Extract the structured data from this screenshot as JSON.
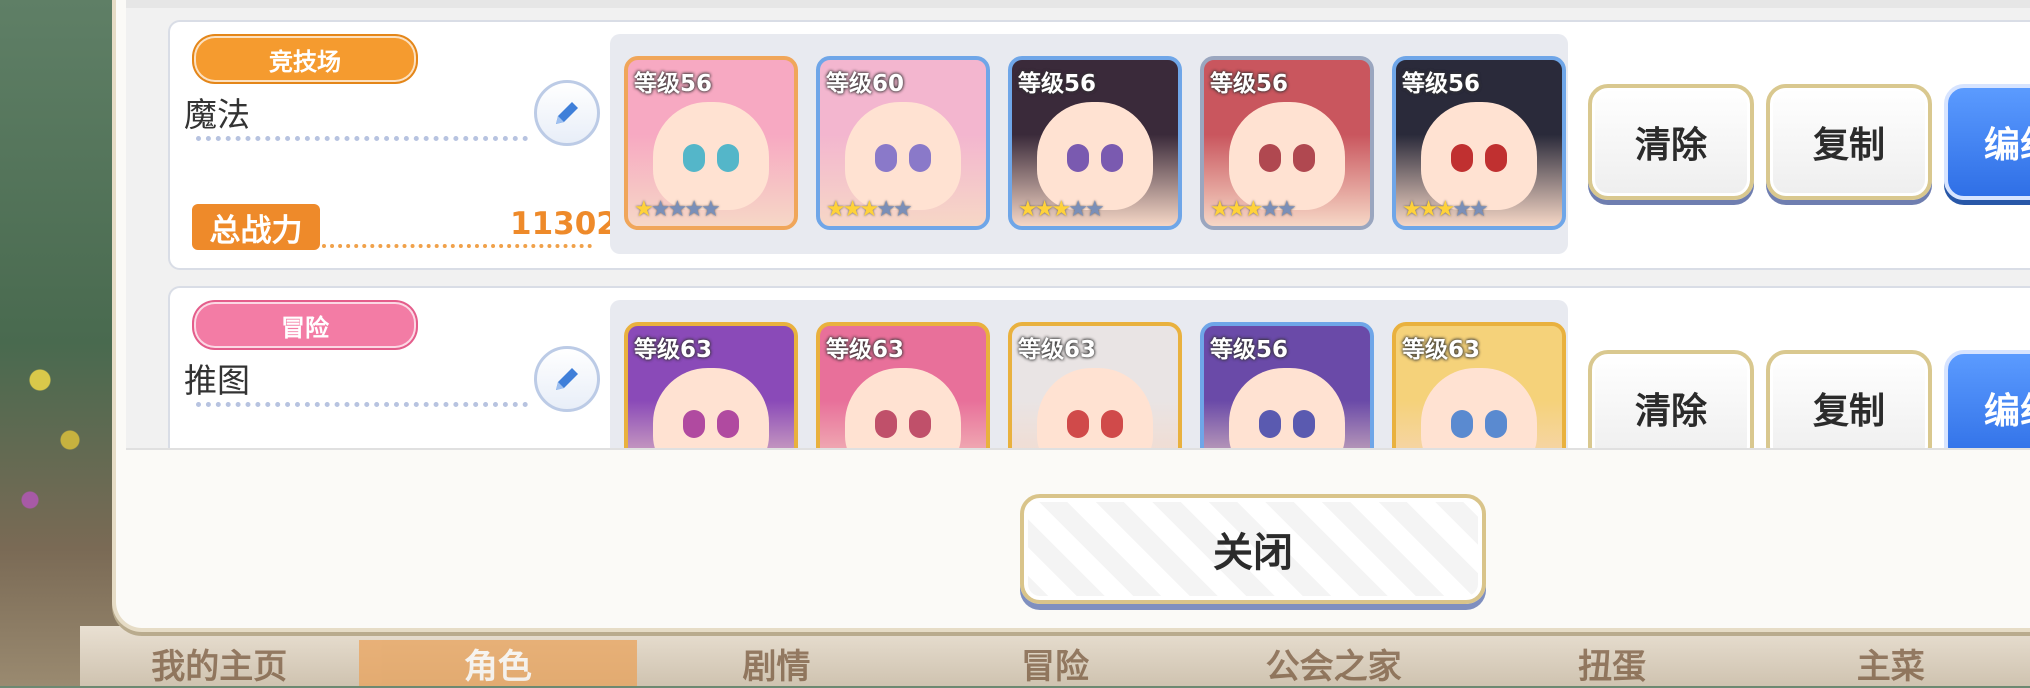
{
  "nav": {
    "tabs": [
      "我的主页",
      "角色",
      "剧情",
      "冒险",
      "公会之家",
      "扭蛋",
      "主菜"
    ]
  },
  "teams": [
    {
      "badge": "竞技场",
      "badge_color": "#f59b2f",
      "name": "魔法",
      "power_label": "总战力",
      "power_value": "11302",
      "characters": [
        {
          "level": "等级56",
          "stars": 1,
          "frame_color": "#f0a65a",
          "hair": "#f7a9c2",
          "eye": "#54b6c9"
        },
        {
          "level": "等级60",
          "stars": 3,
          "frame_color": "#6fa6e8",
          "hair": "#f3b6cf",
          "eye": "#8a79c9"
        },
        {
          "level": "等级56",
          "stars": 3,
          "frame_color": "#6fa6e8",
          "hair": "#3a2a3a",
          "eye": "#7a5ab0"
        },
        {
          "level": "等级56",
          "stars": 3,
          "frame_color": "#9aa6bf",
          "hair": "#c9565e",
          "eye": "#b04850"
        },
        {
          "level": "等级56",
          "stars": 3,
          "frame_color": "#6fa6e8",
          "hair": "#2a2a3a",
          "eye": "#c03030"
        }
      ],
      "buttons": {
        "clear": "清除",
        "copy": "复制",
        "edit": "编组"
      }
    },
    {
      "badge": "冒险",
      "badge_color": "#f37ca5",
      "name": "推图",
      "characters": [
        {
          "level": "等级63",
          "stars": 0,
          "frame_color": "#e9b13e",
          "hair": "#8a4ab8",
          "eye": "#b04aa0"
        },
        {
          "level": "等级63",
          "stars": 0,
          "frame_color": "#e9b13e",
          "hair": "#e8709a",
          "eye": "#c0506a"
        },
        {
          "level": "等级63",
          "stars": 0,
          "frame_color": "#e9b13e",
          "hair": "#e9e4e4",
          "eye": "#d04a4a"
        },
        {
          "level": "等级56",
          "stars": 0,
          "frame_color": "#6fa6e8",
          "hair": "#6a4aa8",
          "eye": "#5a5ab0"
        },
        {
          "level": "等级63",
          "stars": 0,
          "frame_color": "#e9b13e",
          "hair": "#f5d27a",
          "eye": "#5a8ad0"
        }
      ],
      "buttons": {
        "clear": "清除",
        "copy": "复制",
        "edit": "编组"
      }
    }
  ],
  "close_label": "关闭"
}
